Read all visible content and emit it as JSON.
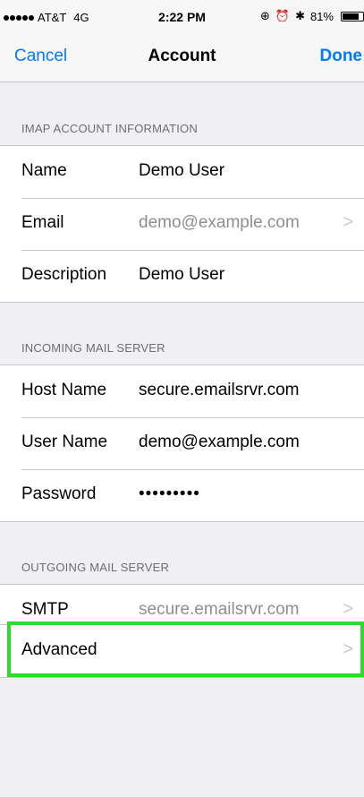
{
  "status_bar": {
    "carrier": "AT&T",
    "network": "4G",
    "time": "2:22 PM",
    "battery_percent": "81%",
    "battery_level": 0.81
  },
  "nav": {
    "cancel_label": "Cancel",
    "title": "Account",
    "done_label": "Done"
  },
  "imap": {
    "header": "IMAP ACCOUNT INFORMATION",
    "rows": [
      {
        "label": "Name",
        "value": "Demo User"
      },
      {
        "label": "Email",
        "value": "demo@example.com"
      },
      {
        "label": "Description",
        "value": "Demo User"
      }
    ]
  },
  "incoming": {
    "header": "INCOMING MAIL SERVER",
    "rows": [
      {
        "label": "Host Name",
        "value": "secure.emailsrvr.com"
      },
      {
        "label": "User Name",
        "value": "demo@example.com"
      },
      {
        "label": "Password",
        "value": "•••••••••"
      }
    ]
  },
  "outgoing": {
    "header": "OUTGOING MAIL SERVER",
    "rows": [
      {
        "label": "SMTP",
        "value": "secure.emailsrvr.com"
      }
    ]
  },
  "advanced": {
    "label": "Advanced"
  },
  "colors": {
    "accent": "#007aff",
    "highlight": "#2ddb2d"
  }
}
